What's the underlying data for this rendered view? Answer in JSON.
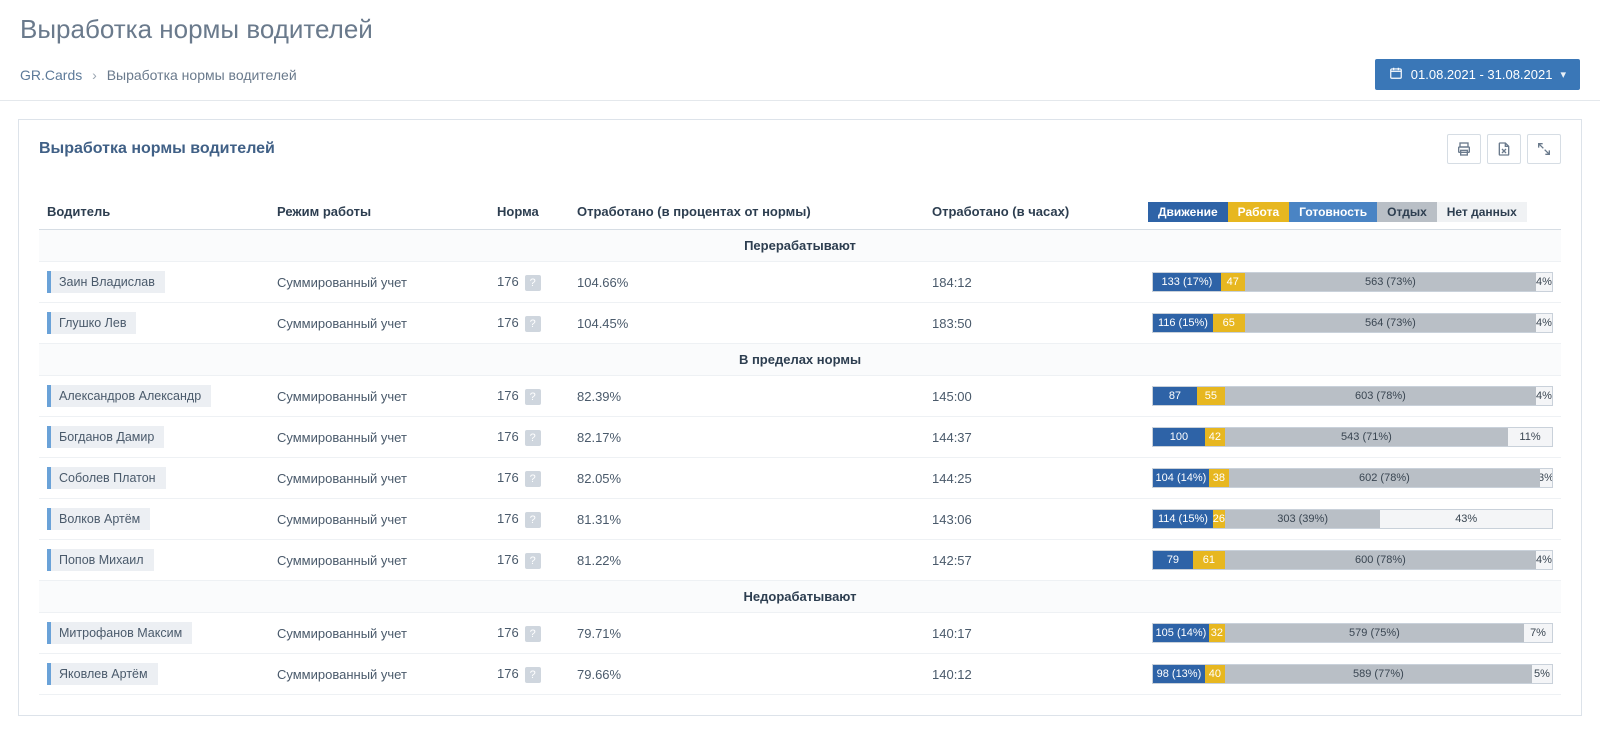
{
  "page": {
    "title": "Выработка нормы водителей",
    "breadcrumb_root": "GR.Cards",
    "breadcrumb_current": "Выработка нормы водителей",
    "date_range": "01.08.2021 - 31.08.2021"
  },
  "panel": {
    "title": "Выработка нормы водителей"
  },
  "columns": {
    "driver": "Водитель",
    "mode": "Режим работы",
    "norm": "Норма",
    "worked_pct": "Отработано (в процентах от нормы)",
    "worked_hours": "Отработано (в часах)"
  },
  "legend": {
    "drive": "Движение",
    "work": "Работа",
    "ready": "Готовность",
    "rest": "Отдых",
    "nodata": "Нет данных"
  },
  "groups": [
    {
      "title": "Перерабатывают",
      "rows": [
        {
          "driver": "Заин Владислав",
          "mode": "Суммированный учет",
          "norm": "176",
          "worked_pct": "104.66%",
          "worked_hours": "184:12",
          "segments": [
            {
              "type": "drive",
              "label": "133 (17%)",
              "width_pct": 17
            },
            {
              "type": "work",
              "label": "47",
              "width_pct": 6
            },
            {
              "type": "rest",
              "label": "563 (73%)",
              "width_pct": 73
            },
            {
              "type": "nodata",
              "label": "4%",
              "width_pct": 4
            }
          ]
        },
        {
          "driver": "Глушко Лев",
          "mode": "Суммированный учет",
          "norm": "176",
          "worked_pct": "104.45%",
          "worked_hours": "183:50",
          "segments": [
            {
              "type": "drive",
              "label": "116 (15%)",
              "width_pct": 15
            },
            {
              "type": "work",
              "label": "65",
              "width_pct": 8
            },
            {
              "type": "rest",
              "label": "564 (73%)",
              "width_pct": 73
            },
            {
              "type": "nodata",
              "label": "4%",
              "width_pct": 4
            }
          ]
        }
      ]
    },
    {
      "title": "В пределах нормы",
      "rows": [
        {
          "driver": "Александров Александр",
          "mode": "Суммированный учет",
          "norm": "176",
          "worked_pct": "82.39%",
          "worked_hours": "145:00",
          "segments": [
            {
              "type": "drive",
              "label": "87",
              "width_pct": 11
            },
            {
              "type": "work",
              "label": "55",
              "width_pct": 7
            },
            {
              "type": "rest",
              "label": "603 (78%)",
              "width_pct": 78
            },
            {
              "type": "nodata",
              "label": "4%",
              "width_pct": 4
            }
          ]
        },
        {
          "driver": "Богданов Дамир",
          "mode": "Суммированный учет",
          "norm": "176",
          "worked_pct": "82.17%",
          "worked_hours": "144:37",
          "segments": [
            {
              "type": "drive",
              "label": "100",
              "width_pct": 13
            },
            {
              "type": "work",
              "label": "42",
              "width_pct": 5
            },
            {
              "type": "rest",
              "label": "543 (71%)",
              "width_pct": 71
            },
            {
              "type": "nodata",
              "label": "11%",
              "width_pct": 11
            }
          ]
        },
        {
          "driver": "Соболев Платон",
          "mode": "Суммированный учет",
          "norm": "176",
          "worked_pct": "82.05%",
          "worked_hours": "144:25",
          "segments": [
            {
              "type": "drive",
              "label": "104 (14%)",
              "width_pct": 14
            },
            {
              "type": "work",
              "label": "38",
              "width_pct": 5
            },
            {
              "type": "rest",
              "label": "602 (78%)",
              "width_pct": 78
            },
            {
              "type": "nodata",
              "label": "3%",
              "width_pct": 3
            }
          ]
        },
        {
          "driver": "Волков Артём",
          "mode": "Суммированный учет",
          "norm": "176",
          "worked_pct": "81.31%",
          "worked_hours": "143:06",
          "segments": [
            {
              "type": "drive",
              "label": "114 (15%)",
              "width_pct": 15
            },
            {
              "type": "work",
              "label": "26",
              "width_pct": 3
            },
            {
              "type": "rest",
              "label": "303 (39%)",
              "width_pct": 39
            },
            {
              "type": "nodata",
              "label": "43%",
              "width_pct": 43
            }
          ]
        },
        {
          "driver": "Попов Михаил",
          "mode": "Суммированный учет",
          "norm": "176",
          "worked_pct": "81.22%",
          "worked_hours": "142:57",
          "segments": [
            {
              "type": "drive",
              "label": "79",
              "width_pct": 10
            },
            {
              "type": "work",
              "label": "61",
              "width_pct": 8
            },
            {
              "type": "rest",
              "label": "600 (78%)",
              "width_pct": 78
            },
            {
              "type": "nodata",
              "label": "4%",
              "width_pct": 4
            }
          ]
        }
      ]
    },
    {
      "title": "Недорабатывают",
      "rows": [
        {
          "driver": "Митрофанов Максим",
          "mode": "Суммированный учет",
          "norm": "176",
          "worked_pct": "79.71%",
          "worked_hours": "140:17",
          "segments": [
            {
              "type": "drive",
              "label": "105 (14%)",
              "width_pct": 14
            },
            {
              "type": "work",
              "label": "32",
              "width_pct": 4
            },
            {
              "type": "rest",
              "label": "579 (75%)",
              "width_pct": 75
            },
            {
              "type": "nodata",
              "label": "7%",
              "width_pct": 7
            }
          ]
        },
        {
          "driver": "Яковлев Артём",
          "mode": "Суммированный учет",
          "norm": "176",
          "worked_pct": "79.66%",
          "worked_hours": "140:12",
          "segments": [
            {
              "type": "drive",
              "label": "98 (13%)",
              "width_pct": 13
            },
            {
              "type": "work",
              "label": "40",
              "width_pct": 5
            },
            {
              "type": "rest",
              "label": "589 (77%)",
              "width_pct": 77
            },
            {
              "type": "nodata",
              "label": "5%",
              "width_pct": 5
            }
          ]
        }
      ]
    }
  ]
}
